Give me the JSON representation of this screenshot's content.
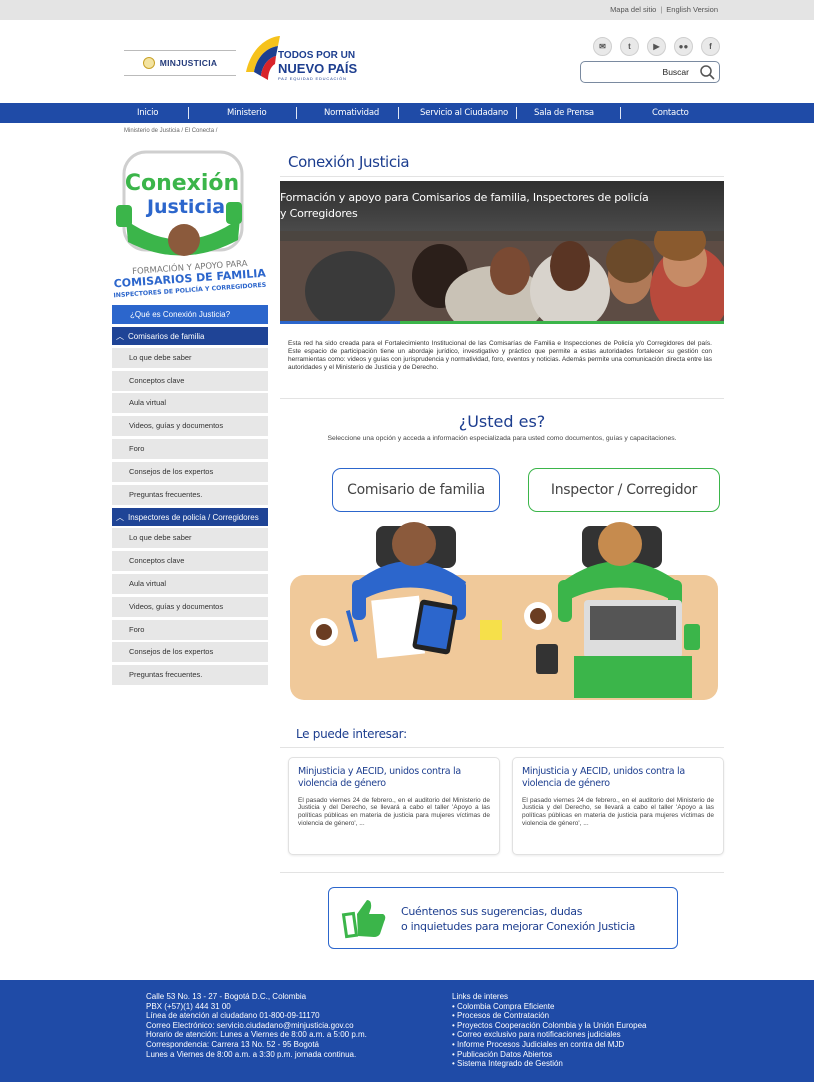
{
  "top_links": {
    "sitemap": "Mapa del sitio",
    "separator": "|",
    "english": "English Version"
  },
  "header": {
    "min_logo": "MINJUSTICIA",
    "gov_line1": "TODOS POR UN",
    "gov_line2": "NUEVO PAÍS",
    "gov_line3": "PAZ EQUIDAD EDUCACIÓN",
    "search_placeholder": "",
    "search_label": "Buscar",
    "social_icons": [
      "mail-icon",
      "twitter-icon",
      "youtube-icon",
      "flickr-icon",
      "facebook-icon"
    ]
  },
  "nav": [
    "Inicio",
    "Ministerio",
    "Normatividad",
    "Servicio al Ciudadano",
    "Sala de Prensa",
    "Contacto"
  ],
  "breadcrumb": "Ministerio de Justicia / El Conecta /",
  "sidebar_logo": {
    "title1": "Conexión",
    "title2": "Justicia",
    "sub1": "FORMACIÓN Y APOYO PARA",
    "sub2": "COMISARIOS DE FAMILIA",
    "sub3": "INSPECTORES DE POLICÍA Y CORREGIDORES"
  },
  "sidebar": {
    "active": "¿Qué es Conexión Justicia?",
    "group1": {
      "title": "Comisarios de familia",
      "items": [
        "Lo que debe saber",
        "Conceptos clave",
        "Aula virtual",
        "Videos, guías y documentos",
        "Foro",
        "Consejos de los expertos",
        "Preguntas frecuentes."
      ]
    },
    "group2": {
      "title": "Inspectores de policía / Corregidores",
      "items": [
        "Lo que debe saber",
        "Conceptos clave",
        "Aula virtual",
        "Videos, guías y documentos",
        "Foro",
        "Consejos de los expertos",
        "Preguntas frecuentes."
      ]
    }
  },
  "main": {
    "title": "Conexión Justicia",
    "banner_line1": "Formación y apoyo para Comisarios de familia, Inspectores de policía",
    "banner_line2": "y Corregidores",
    "intro": "Esta red ha sido creada para el Fortalecimiento Institucional de las Comisarías de Familia e Inspecciones de Policía y/o Corregidores del país. Este espacio de participación tiene un abordaje jurídico, investigativo y práctico que permite a estas autoridades fortalecer su gestión con herramientas como: videos y guías con jurisprudencia y normatividad, foro, eventos y noticias. Además permite una comunicación directa entre las autoridades y el Ministerio de Justicia y de Derecho.",
    "question": "¿Usted es?",
    "question_sub": "Seleccione una opción y acceda a información especializada para usted como documentos, guías y capacitaciones.",
    "choice1": "Comisario de familia",
    "choice2": "Inspector / Corregidor",
    "interest_title": "Le puede interesar:",
    "cards": [
      {
        "title": "Minjusticia y AECID, unidos contra la violencia de género",
        "body": "El pasado viernes 24 de febrero., en el auditorio del Ministerio de Justicia y del Derecho, se llevará a cabo el taller 'Apoyo a las políticas públicas en materia de justicia para mujeres víctimas de violencia de género', ..."
      },
      {
        "title": "Minjusticia y AECID, unidos contra la violencia de género",
        "body": "El pasado viernes 24 de febrero., en el auditorio del Ministerio de Justicia y del Derecho, se llevará a cabo el taller 'Apoyo a las políticas públicas en materia de justicia para mujeres víctimas de violencia de género', ..."
      }
    ],
    "feedback_line1": "Cuéntenos sus sugerencias, dudas",
    "feedback_line2": "o inquietudes para mejorar Conexión Justicia"
  },
  "footer": {
    "contact": [
      "Calle 53 No. 13 - 27 - Bogotá D.C., Colombia",
      "PBX (+57)(1) 444 31 00",
      "Línea de atención al ciudadano 01-800-09-11170",
      "Correo Electrónico: servicio.ciudadano@minjusticia.gov.co",
      "Horario de atención: Lunes a Viernes de 8:00 a.m. a 5:00 p.m.",
      "Correspondencia: Carrera 13 No. 52 - 95 Bogotá",
      "Lunes a Viernes de 8:00 a.m. a 3:30 p.m. jornada continua."
    ],
    "links_title": "Links de interes",
    "links": [
      "• Colombia Compra Eficiente",
      "• Procesos de Contratación",
      "• Proyectos Cooperación Colombia y la Unión Europea",
      "• Correo exclusivo para notificaciones judiciales",
      "• Informe Procesos Judiciales en contra del MJD",
      "• Publicación Datos Abiertos",
      "• Sistema Integrado de Gestión"
    ]
  },
  "colors": {
    "brand_blue": "#1f4ba7",
    "accent_blue": "#2c66cc",
    "accent_green": "#3bb54a",
    "title_blue": "#1d3e8f"
  }
}
